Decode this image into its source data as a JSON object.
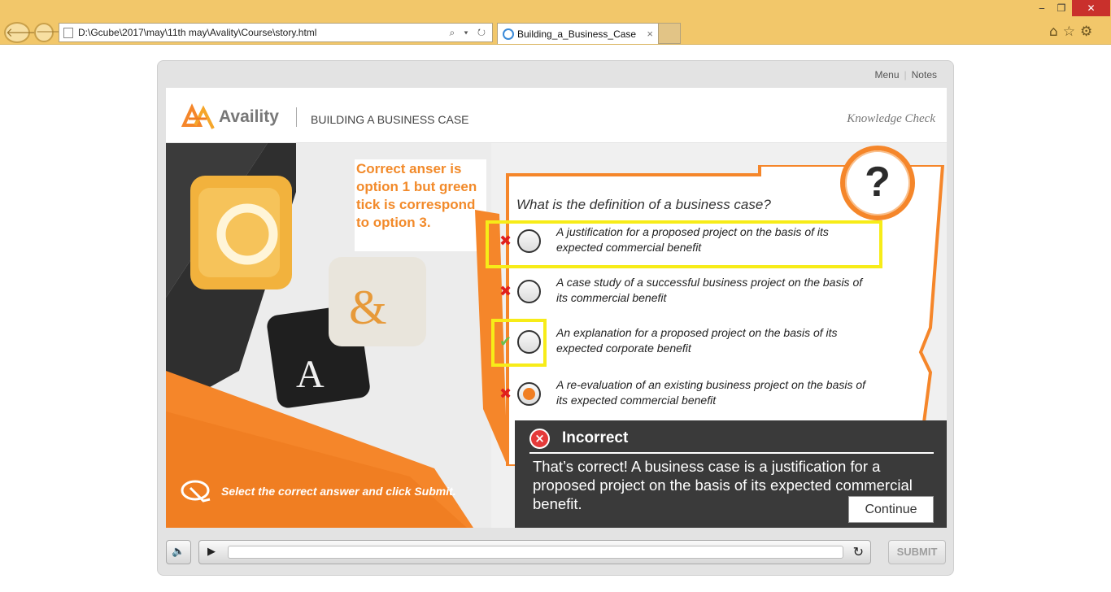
{
  "browser": {
    "address": "D:\\Gcube\\2017\\may\\11th may\\Avality\\Course\\story.html",
    "tab_title": "Building_a_Business_Case",
    "tab_close": "×",
    "address_tools": "⌕ ▾ ↻",
    "window_min": "‒",
    "window_max": "❐",
    "window_close": "✕",
    "toolbar_icons": "⌂☆⚙"
  },
  "player": {
    "menu_link": "Menu",
    "notes_link": "Notes",
    "submit_label": "SUBMIT"
  },
  "header": {
    "logo_text": "Availity",
    "course_title": "BUILDING A BUSINESS CASE",
    "section_label": "Knowledge Check"
  },
  "annotation": "Correct anser is option 1 but green tick is correspond to option 3.",
  "instruction": "Select the correct answer and click Submit.",
  "question": {
    "mark": "?",
    "text": "What is the definition of a business case?",
    "options": [
      {
        "mark": "✖",
        "text": "A justification for a proposed project on the basis of its expected commercial benefit",
        "selected": false,
        "marked_correct": false
      },
      {
        "mark": "✖",
        "text": "A case study of a successful business project on the basis of its commercial benefit",
        "selected": false,
        "marked_correct": false
      },
      {
        "mark": "✔",
        "text": "An explanation for a proposed project on the basis of its expected corporate benefit",
        "selected": false,
        "marked_correct": true
      },
      {
        "mark": "✖",
        "text": "A re-evaluation of an existing business project on the basis of its expected commercial benefit",
        "selected": true,
        "marked_correct": false
      }
    ]
  },
  "feedback": {
    "icon": "×",
    "title": "Incorrect",
    "message": "That’s correct! A business case is a justification for a proposed project on the basis of its expected commercial benefit.",
    "continue_label": "Continue"
  },
  "colors": {
    "accent_orange": "#f5862a",
    "highlight_yellow": "#f7ec18",
    "incorrect_red": "#e0201e",
    "correct_green": "#6bbf4a"
  }
}
